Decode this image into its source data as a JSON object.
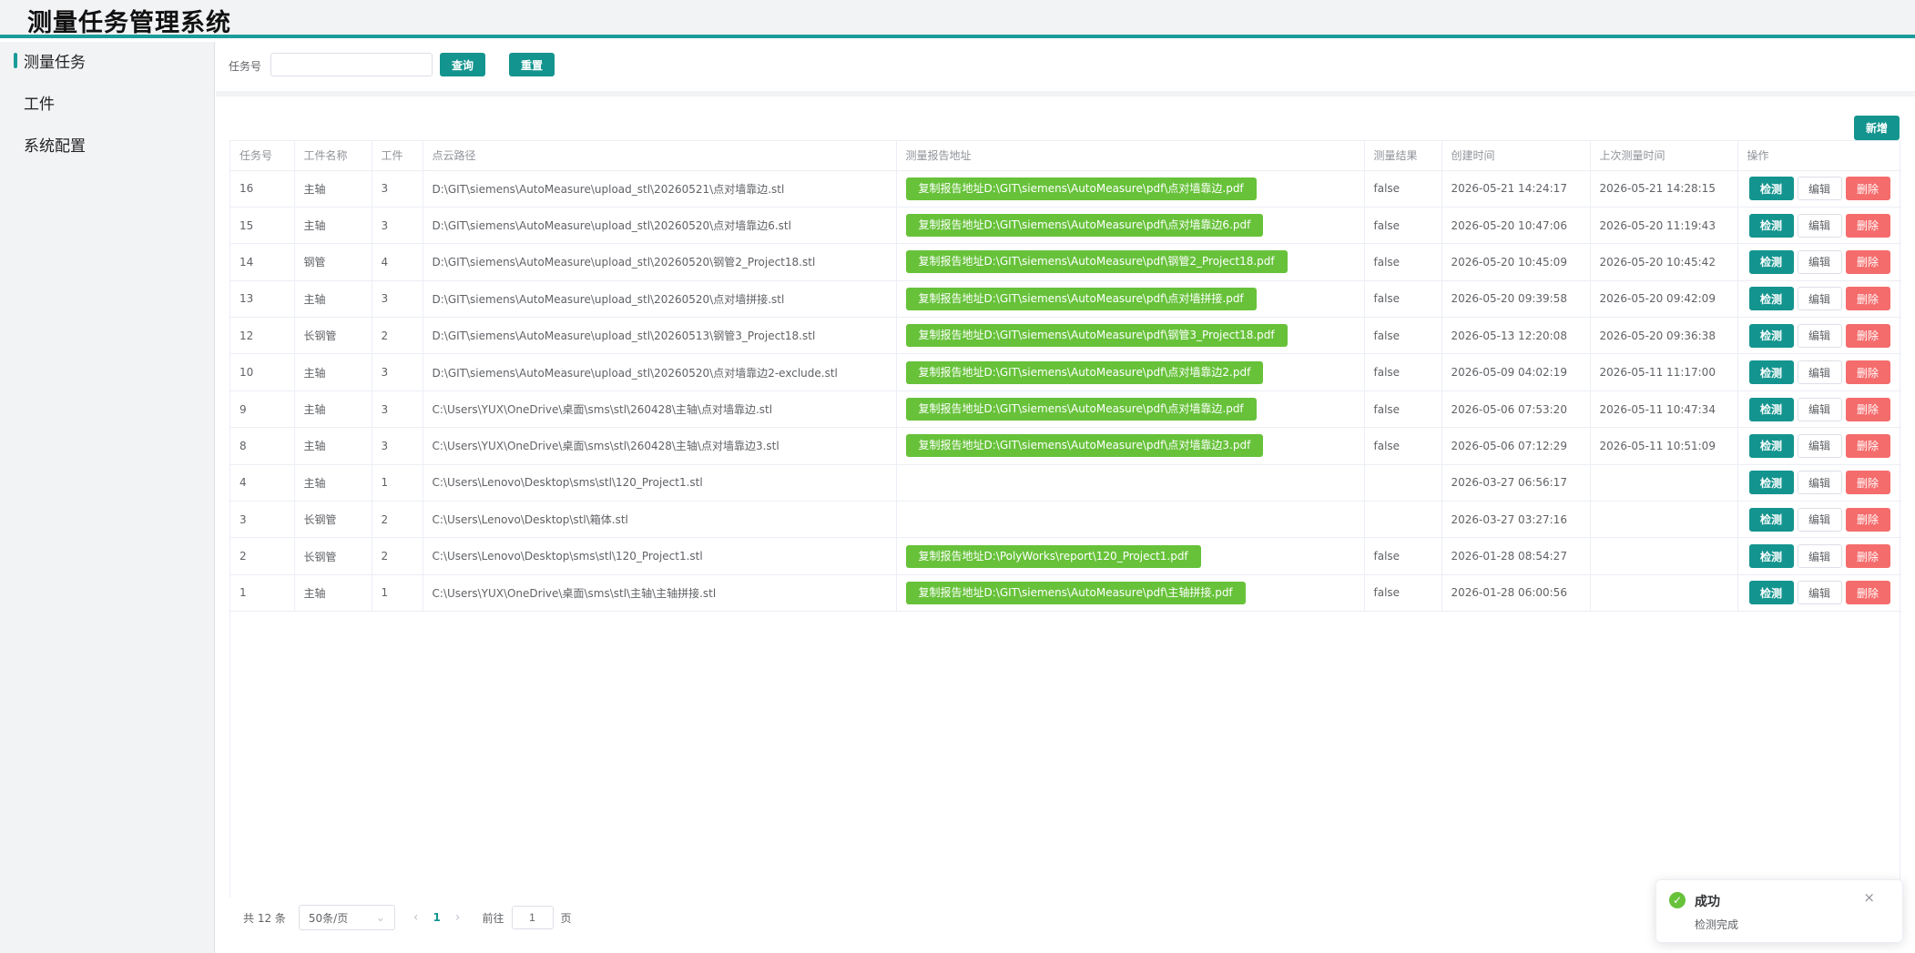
{
  "app": {
    "title": "测量任务管理系统"
  },
  "sidebar": {
    "items": [
      {
        "label": "测量任务"
      },
      {
        "label": "工件"
      },
      {
        "label": "系统配置"
      }
    ]
  },
  "search": {
    "label": "任务号",
    "value": "",
    "placeholder": "",
    "query_label": "查询",
    "reset_label": "重置"
  },
  "toolbar": {
    "add_label": "新增"
  },
  "table": {
    "headers": [
      "任务号",
      "工件名称",
      "工件",
      "点云路径",
      "测量报告地址",
      "测量结果",
      "创建时间",
      "上次测量时间",
      "操作"
    ],
    "actions": {
      "detect": "检测",
      "edit": "编辑",
      "delete": "删除"
    },
    "rows": [
      {
        "id": "16",
        "name": "主轴",
        "part": "3",
        "path": "D:\\GIT\\siemens\\AutoMeasure\\upload_stl\\20260521\\点对墙靠边.stl",
        "report": "复制报告地址D:\\GIT\\siemens\\AutoMeasure\\pdf\\点对墙靠边.pdf",
        "result": "false",
        "created": "2026-05-21 14:24:17",
        "last": "2026-05-21 14:28:15"
      },
      {
        "id": "15",
        "name": "主轴",
        "part": "3",
        "path": "D:\\GIT\\siemens\\AutoMeasure\\upload_stl\\20260520\\点对墙靠边6.stl",
        "report": "复制报告地址D:\\GIT\\siemens\\AutoMeasure\\pdf\\点对墙靠边6.pdf",
        "result": "false",
        "created": "2026-05-20 10:47:06",
        "last": "2026-05-20 11:19:43"
      },
      {
        "id": "14",
        "name": "钢管",
        "part": "4",
        "path": "D:\\GIT\\siemens\\AutoMeasure\\upload_stl\\20260520\\钢管2_Project18.stl",
        "report": "复制报告地址D:\\GIT\\siemens\\AutoMeasure\\pdf\\钢管2_Project18.pdf",
        "result": "false",
        "created": "2026-05-20 10:45:09",
        "last": "2026-05-20 10:45:42"
      },
      {
        "id": "13",
        "name": "主轴",
        "part": "3",
        "path": "D:\\GIT\\siemens\\AutoMeasure\\upload_stl\\20260520\\点对墙拼接.stl",
        "report": "复制报告地址D:\\GIT\\siemens\\AutoMeasure\\pdf\\点对墙拼接.pdf",
        "result": "false",
        "created": "2026-05-20 09:39:58",
        "last": "2026-05-20 09:42:09"
      },
      {
        "id": "12",
        "name": "长钢管",
        "part": "2",
        "path": "D:\\GIT\\siemens\\AutoMeasure\\upload_stl\\20260513\\钢管3_Project18.stl",
        "report": "复制报告地址D:\\GIT\\siemens\\AutoMeasure\\pdf\\钢管3_Project18.pdf",
        "result": "false",
        "created": "2026-05-13 12:20:08",
        "last": "2026-05-20 09:36:38"
      },
      {
        "id": "10",
        "name": "主轴",
        "part": "3",
        "path": "D:\\GIT\\siemens\\AutoMeasure\\upload_stl\\20260520\\点对墙靠边2-exclude.stl",
        "report": "复制报告地址D:\\GIT\\siemens\\AutoMeasure\\pdf\\点对墙靠边2.pdf",
        "result": "false",
        "created": "2026-05-09 04:02:19",
        "last": "2026-05-11 11:17:00"
      },
      {
        "id": "9",
        "name": "主轴",
        "part": "3",
        "path": "C:\\Users\\YUX\\OneDrive\\桌面\\sms\\stl\\260428\\主轴\\点对墙靠边.stl",
        "report": "复制报告地址D:\\GIT\\siemens\\AutoMeasure\\pdf\\点对墙靠边.pdf",
        "result": "false",
        "created": "2026-05-06 07:53:20",
        "last": "2026-05-11 10:47:34"
      },
      {
        "id": "8",
        "name": "主轴",
        "part": "3",
        "path": "C:\\Users\\YUX\\OneDrive\\桌面\\sms\\stl\\260428\\主轴\\点对墙靠边3.stl",
        "report": "复制报告地址D:\\GIT\\siemens\\AutoMeasure\\pdf\\点对墙靠边3.pdf",
        "result": "false",
        "created": "2026-05-06 07:12:29",
        "last": "2026-05-11 10:51:09"
      },
      {
        "id": "4",
        "name": "主轴",
        "part": "1",
        "path": "C:\\Users\\Lenovo\\Desktop\\sms\\stl\\120_Project1.stl",
        "report": "",
        "result": "",
        "created": "2026-03-27 06:56:17",
        "last": ""
      },
      {
        "id": "3",
        "name": "长钢管",
        "part": "2",
        "path": "C:\\Users\\Lenovo\\Desktop\\stl\\箱体.stl",
        "report": "",
        "result": "",
        "created": "2026-03-27 03:27:16",
        "last": ""
      },
      {
        "id": "2",
        "name": "长钢管",
        "part": "2",
        "path": "C:\\Users\\Lenovo\\Desktop\\sms\\stl\\120_Project1.stl",
        "report": "复制报告地址D:\\PolyWorks\\report\\120_Project1.pdf",
        "result": "false",
        "created": "2026-01-28 08:54:27",
        "last": ""
      },
      {
        "id": "1",
        "name": "主轴",
        "part": "1",
        "path": "C:\\Users\\YUX\\OneDrive\\桌面\\sms\\stl\\主轴\\主轴拼接.stl",
        "report": "复制报告地址D:\\GIT\\siemens\\AutoMeasure\\pdf\\主轴拼接.pdf",
        "result": "false",
        "created": "2026-01-28 06:00:56",
        "last": ""
      }
    ]
  },
  "pagination": {
    "total_label": "共 12 条",
    "page_size": "50条/页",
    "prev": "‹",
    "next": "›",
    "current_page": "1",
    "goto_label": "前往",
    "goto_value": "1",
    "page_suffix": "页"
  },
  "toast": {
    "title": "成功",
    "message": "检测完成",
    "close": "×",
    "icon": "check-circle-icon"
  },
  "colors": {
    "accent": "#14948f",
    "success": "#67c23a",
    "danger": "#f56c6c"
  }
}
